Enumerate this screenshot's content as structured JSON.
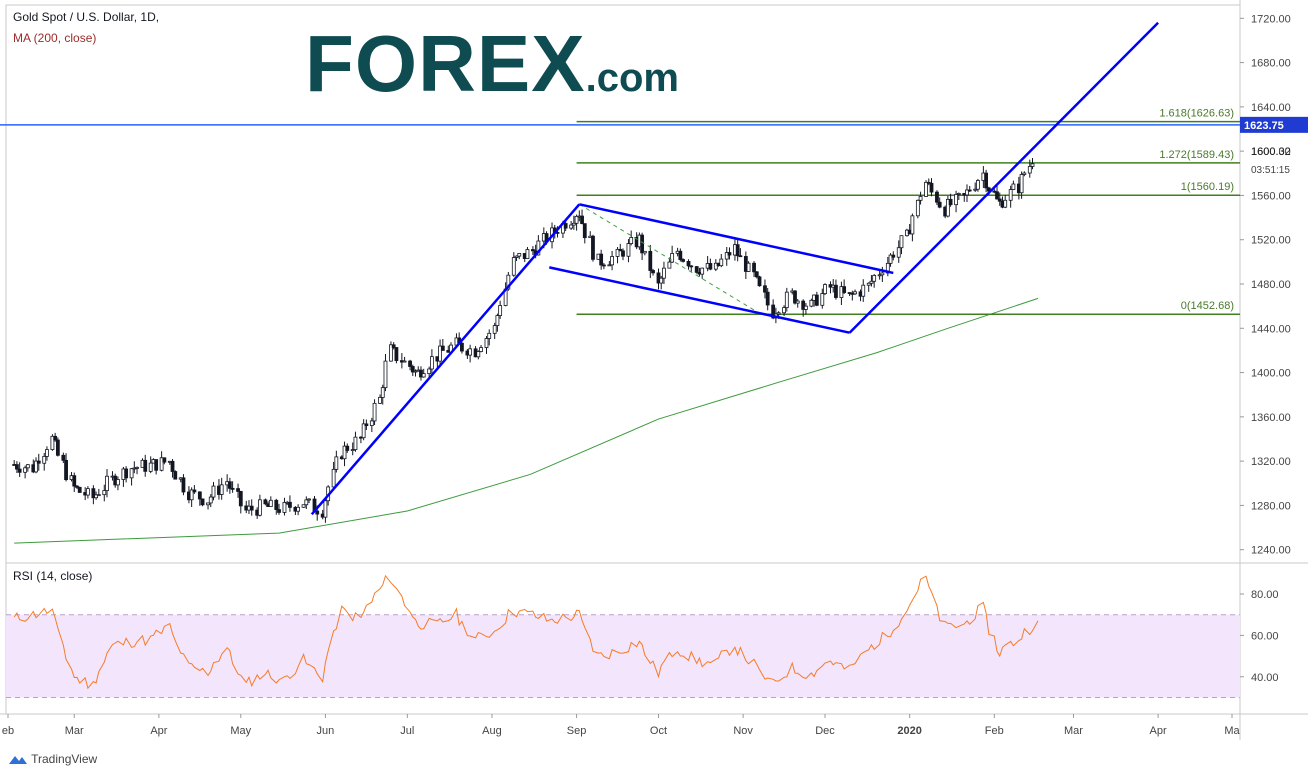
{
  "header": {
    "title": "Gold Spot / U.S. Dollar, 1D,",
    "ma_label": "MA (200, close)",
    "rsi_label": "RSI (14, close)"
  },
  "logo": {
    "main": "FOREX",
    "suffix": ".com"
  },
  "footer": {
    "brand": "TradingView"
  },
  "colors": {
    "up_candle": "#ffffff",
    "candle_outline": "#131722",
    "ma": "#3d9b3d",
    "trend": "#0000ff",
    "fib": "#3f7f1f",
    "price_line": "#2962ff",
    "rsi": "#f57c2a",
    "rsi_band": "#f3e5fb",
    "logo": "#0e4c52"
  },
  "chart_data": [
    {
      "type": "candlestick",
      "title": "Gold Spot / U.S. Dollar, 1D,",
      "x_tick_labels": [
        "eb",
        "Mar",
        "Apr",
        "May",
        "Jun",
        "Jul",
        "Aug",
        "Sep",
        "Oct",
        "Nov",
        "Dec",
        "2020",
        "Feb",
        "Mar",
        "Apr",
        "Ma"
      ],
      "y_tick_labels": [
        "1240.00",
        "1280.00",
        "1320.00",
        "1360.00",
        "1400.00",
        "1440.00",
        "1480.00",
        "1520.00",
        "1560.00",
        "1600.00",
        "1640.00",
        "1680.00",
        "1720.00"
      ],
      "ylim": [
        1228,
        1732
      ],
      "close_path": [
        [
          "2019-02-07",
          1317
        ],
        [
          "2019-02-14",
          1314
        ],
        [
          "2019-02-21",
          1340
        ],
        [
          "2019-03-01",
          1296
        ],
        [
          "2019-03-08",
          1287
        ],
        [
          "2019-03-15",
          1303
        ],
        [
          "2019-03-22",
          1314
        ],
        [
          "2019-03-29",
          1316
        ],
        [
          "2019-04-05",
          1320
        ],
        [
          "2019-04-12",
          1292
        ],
        [
          "2019-04-19",
          1285
        ],
        [
          "2019-04-26",
          1302
        ],
        [
          "2019-05-03",
          1275
        ],
        [
          "2019-05-10",
          1279
        ],
        [
          "2019-05-17",
          1277
        ],
        [
          "2019-05-24",
          1283
        ],
        [
          "2019-05-31",
          1276
        ],
        [
          "2019-06-07",
          1328
        ],
        [
          "2019-06-14",
          1340
        ],
        [
          "2019-06-21",
          1376
        ],
        [
          "2019-06-25",
          1420
        ],
        [
          "2019-07-05",
          1400
        ],
        [
          "2019-07-12",
          1415
        ],
        [
          "2019-07-19",
          1425
        ],
        [
          "2019-07-26",
          1420
        ],
        [
          "2019-08-02",
          1440
        ],
        [
          "2019-08-09",
          1500
        ],
        [
          "2019-08-16",
          1510
        ],
        [
          "2019-08-23",
          1525
        ],
        [
          "2019-09-02",
          1545
        ],
        [
          "2019-09-09",
          1500
        ],
        [
          "2019-09-16",
          1505
        ],
        [
          "2019-09-24",
          1520
        ],
        [
          "2019-10-01",
          1478
        ],
        [
          "2019-10-08",
          1510
        ],
        [
          "2019-10-15",
          1495
        ],
        [
          "2019-10-22",
          1493
        ],
        [
          "2019-10-29",
          1512
        ],
        [
          "2019-11-05",
          1487
        ],
        [
          "2019-11-12",
          1455
        ],
        [
          "2019-11-19",
          1470
        ],
        [
          "2019-11-26",
          1460
        ],
        [
          "2019-12-03",
          1477
        ],
        [
          "2019-12-10",
          1468
        ],
        [
          "2019-12-17",
          1478
        ],
        [
          "2019-12-24",
          1500
        ],
        [
          "2019-12-31",
          1522
        ],
        [
          "2020-01-07",
          1572
        ],
        [
          "2020-01-14",
          1548
        ],
        [
          "2020-01-21",
          1558
        ],
        [
          "2020-01-28",
          1580
        ],
        [
          "2020-02-03",
          1553
        ],
        [
          "2020-02-10",
          1568
        ],
        [
          "2020-02-17",
          1600
        ]
      ],
      "overlays": [
        {
          "name": "MA (200, close)",
          "points": [
            [
              "2019-02-07",
              1246
            ],
            [
              "2019-05-15",
              1255
            ],
            [
              "2019-07-01",
              1275
            ],
            [
              "2019-08-15",
              1308
            ],
            [
              "2019-10-01",
              1358
            ],
            [
              "2019-11-15",
              1392
            ],
            [
              "2019-12-20",
              1418
            ],
            [
              "2020-01-15",
              1440
            ],
            [
              "2020-02-17",
              1467
            ]
          ]
        }
      ],
      "trendlines": [
        [
          [
            "2019-05-27",
            1272
          ],
          [
            "2019-09-02",
            1552
          ]
        ],
        [
          [
            "2019-09-02",
            1552
          ],
          [
            "2019-12-26",
            1490
          ]
        ],
        [
          [
            "2019-08-22",
            1495
          ],
          [
            "2019-12-10",
            1436
          ]
        ],
        [
          [
            "2019-12-10",
            1436
          ],
          [
            "2020-04-01",
            1716
          ]
        ]
      ],
      "fib_levels": [
        {
          "label": "1.618(1626.63)",
          "value": 1626.63
        },
        {
          "label": "1.272(1589.43)",
          "value": 1589.43
        },
        {
          "label": "1(1560.19)",
          "value": 1560.19
        },
        {
          "label": "0(1452.68)",
          "value": 1452.68
        }
      ],
      "price_line": {
        "label": "1623.75",
        "value": 1623.75
      },
      "last_price": {
        "label": "1600.32",
        "value": 1600.32,
        "countdown": "03:51:15"
      }
    },
    {
      "type": "line",
      "title": "RSI (14, close)",
      "y_tick_labels": [
        "40.00",
        "60.00",
        "80.00"
      ],
      "ylim": [
        22,
        95
      ],
      "bands": [
        30,
        70
      ],
      "series": [
        {
          "points": [
            [
              "2019-02-07",
              68
            ],
            [
              "2019-02-21",
              72
            ],
            [
              "2019-03-01",
              40
            ],
            [
              "2019-03-08",
              36
            ],
            [
              "2019-03-15",
              55
            ],
            [
              "2019-03-22",
              57
            ],
            [
              "2019-03-29",
              58
            ],
            [
              "2019-04-05",
              64
            ],
            [
              "2019-04-12",
              45
            ],
            [
              "2019-04-19",
              42
            ],
            [
              "2019-04-26",
              54
            ],
            [
              "2019-05-03",
              36
            ],
            [
              "2019-05-10",
              42
            ],
            [
              "2019-05-17",
              38
            ],
            [
              "2019-05-24",
              48
            ],
            [
              "2019-05-31",
              40
            ],
            [
              "2019-06-07",
              72
            ],
            [
              "2019-06-14",
              68
            ],
            [
              "2019-06-21",
              82
            ],
            [
              "2019-06-25",
              88
            ],
            [
              "2019-07-05",
              66
            ],
            [
              "2019-07-12",
              65
            ],
            [
              "2019-07-19",
              70
            ],
            [
              "2019-07-26",
              58
            ],
            [
              "2019-08-02",
              62
            ],
            [
              "2019-08-09",
              72
            ],
            [
              "2019-08-16",
              70
            ],
            [
              "2019-08-23",
              67
            ],
            [
              "2019-09-02",
              70
            ],
            [
              "2019-09-09",
              50
            ],
            [
              "2019-09-16",
              52
            ],
            [
              "2019-09-24",
              57
            ],
            [
              "2019-10-01",
              42
            ],
            [
              "2019-10-08",
              54
            ],
            [
              "2019-10-15",
              48
            ],
            [
              "2019-10-22",
              46
            ],
            [
              "2019-10-29",
              55
            ],
            [
              "2019-11-05",
              46
            ],
            [
              "2019-11-12",
              36
            ],
            [
              "2019-11-19",
              44
            ],
            [
              "2019-11-26",
              41
            ],
            [
              "2019-12-03",
              48
            ],
            [
              "2019-12-10",
              43
            ],
            [
              "2019-12-17",
              53
            ],
            [
              "2019-12-24",
              60
            ],
            [
              "2019-12-31",
              72
            ],
            [
              "2020-01-07",
              88
            ],
            [
              "2020-01-14",
              64
            ],
            [
              "2020-01-21",
              65
            ],
            [
              "2020-01-28",
              73
            ],
            [
              "2020-02-03",
              52
            ],
            [
              "2020-02-10",
              58
            ],
            [
              "2020-02-17",
              67
            ]
          ]
        }
      ]
    }
  ]
}
